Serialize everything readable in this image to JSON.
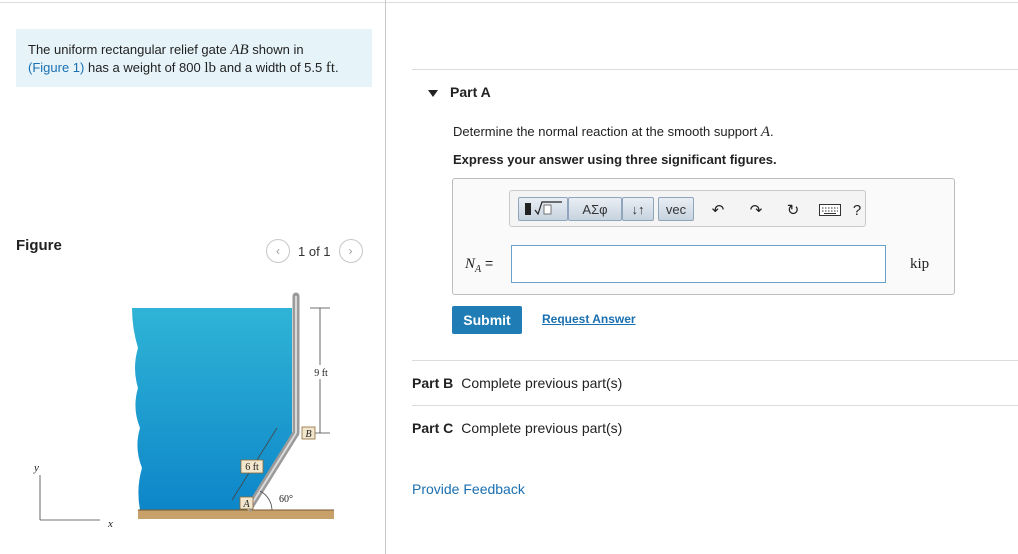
{
  "problem": {
    "line1_pre": "The uniform rectangular relief gate ",
    "gate_name": "AB",
    "line1_post": " shown in",
    "figure_link": "(Figure 1)",
    "line2_pre": " has a weight of 800 ",
    "weight_unit": "lb",
    "line2_mid": " and a width of 5.5 ",
    "width_unit": "ft",
    "line2_end": "."
  },
  "figure": {
    "label": "Figure",
    "pager_text": "1 of 1",
    "prev_icon": "chevron-left-icon",
    "next_icon": "chevron-right-icon",
    "dim_9ft": "9 ft",
    "dim_6ft": "6 ft",
    "angle": "60°",
    "point_a": "A",
    "point_b": "B",
    "axis_x": "x",
    "axis_y": "y",
    "colors": {
      "water_top": "#2fb4d6",
      "water_bottom": "#0d86c9",
      "ground": "#c8a06a",
      "gate": "#b9b9b9"
    }
  },
  "part_a": {
    "title": "Part A",
    "question_pre": "Determine the normal reaction at the smooth support ",
    "question_var": "A",
    "question_post": ".",
    "instruction": "Express your answer using three significant figures.",
    "toolbar": {
      "templates_icon": "templates-sqrt-icon",
      "greek": "ΑΣφ",
      "updown": "↓↑",
      "vec": "vec",
      "undo_icon": "undo-icon",
      "redo_icon": "redo-icon",
      "reset_icon": "reset-icon",
      "keyboard_icon": "keyboard-icon",
      "help": "?"
    },
    "variable_label": "N",
    "variable_sub": "A",
    "equals": " =",
    "input_value": "",
    "unit": "kip",
    "submit_label": "Submit",
    "request_label": "Request Answer"
  },
  "part_b": {
    "label": "Part B",
    "status": "Complete previous part(s)"
  },
  "part_c": {
    "label": "Part C",
    "status": "Complete previous part(s)"
  },
  "feedback_label": "Provide Feedback"
}
